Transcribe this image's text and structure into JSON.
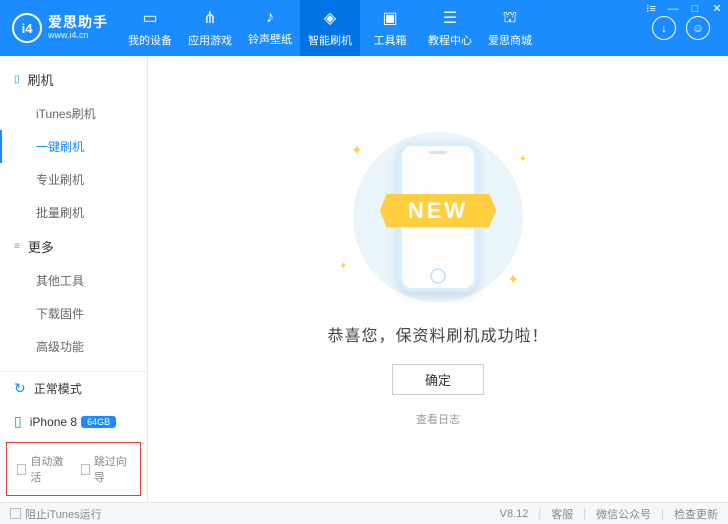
{
  "logo": {
    "badge": "i4",
    "title": "爱思助手",
    "url": "www.i4.cn"
  },
  "nav": [
    {
      "label": "我的设备"
    },
    {
      "label": "应用游戏"
    },
    {
      "label": "铃声壁纸"
    },
    {
      "label": "智能刷机"
    },
    {
      "label": "工具箱"
    },
    {
      "label": "教程中心"
    },
    {
      "label": "爱思商城"
    }
  ],
  "sidebar": {
    "header1": "刷机",
    "group1": [
      "iTunes刷机",
      "一键刷机",
      "专业刷机",
      "批量刷机"
    ],
    "header2": "更多",
    "group2": [
      "其他工具",
      "下载固件",
      "高级功能"
    ],
    "mode": "正常模式",
    "device": {
      "name": "iPhone 8",
      "storage": "64GB"
    },
    "checks": [
      "自动激活",
      "跳过向导"
    ]
  },
  "main": {
    "ribbon": "NEW",
    "message": "恭喜您，保资料刷机成功啦！",
    "ok": "确定",
    "log": "查看日志"
  },
  "footer": {
    "block_itunes": "阻止iTunes运行",
    "version": "V8.12",
    "svc": "客服",
    "wx": "微信公众号",
    "upd": "检查更新"
  }
}
